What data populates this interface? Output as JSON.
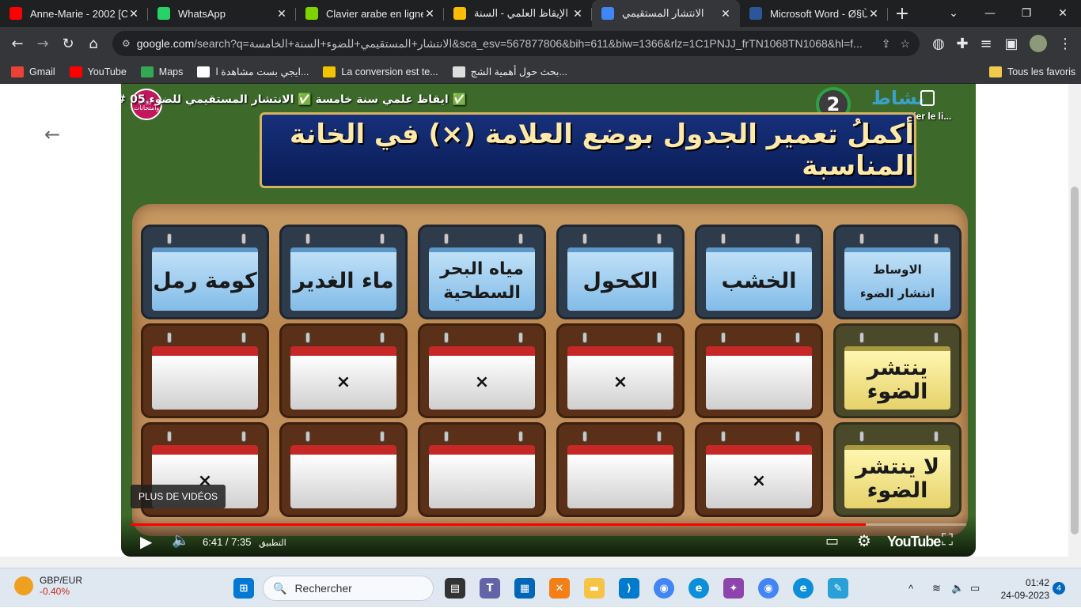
{
  "browser": {
    "tabs": [
      {
        "title": "Anne-Marie - 2002 [O",
        "favicon": "youtube-icon",
        "color": "#ff0000",
        "active": false
      },
      {
        "title": "WhatsApp",
        "favicon": "whatsapp-icon",
        "color": "#25d366",
        "active": false
      },
      {
        "title": "Clavier arabe en ligne",
        "favicon": "clavier-icon",
        "color": "#7fd400",
        "active": false
      },
      {
        "title": "الإيقاظ العلمي - السنة",
        "favicon": "drive-icon",
        "color": "#fbbc04",
        "active": false
      },
      {
        "title": "الانتشار المستقيمي",
        "favicon": "google-icon",
        "color": "#4285f4",
        "active": true
      },
      {
        "title": "Microsoft Word - Ø§Ù",
        "favicon": "word-icon",
        "color": "#2b579a",
        "active": false
      }
    ],
    "new_tab_label": "+",
    "url_domain": "google.com",
    "url_rest": "/search?q=الانتشار+المستقيمي+للضوء+السنة+الخامسة&sca_esv=567877806&bih=611&biw=1366&rlz=1C1PNJJ_frTN1068TN1068&hl=f...",
    "bookmarks": [
      {
        "label": "Gmail",
        "icon": "gmail-icon",
        "color": "#ea4335"
      },
      {
        "label": "YouTube",
        "icon": "youtube-icon",
        "color": "#ff0000"
      },
      {
        "label": "Maps",
        "icon": "maps-icon",
        "color": "#34a853"
      },
      {
        "label": "ايجي بست مشاهدة ا...",
        "icon": "egybest-icon",
        "color": "#ffffff"
      },
      {
        "label": "La conversion est te...",
        "icon": "conversion-icon",
        "color": "#f2c300"
      },
      {
        "label": "بحث حول أهمية الشج...",
        "icon": "doc-icon",
        "color": "#dddddd"
      }
    ],
    "all_bookmarks_label": "Tous les favoris"
  },
  "video": {
    "title": "✅ ايقاظ علمي سنة خامسة ✅ الانتشار المستقيمي للضوء 05 #",
    "channel_avatar_text": "دروس وامتحانات",
    "badge_number": "2",
    "activity_label": "نشاط",
    "copy_link_label": "Copier le li...",
    "banner_text": "أكملُ تعمير الجدول بوضع العلامة (×) في الخانة المناسبة",
    "more_videos_label": "PLUS DE VIDÉOS",
    "time_current": "6:41",
    "time_total": "7:35",
    "chapter_label": "التطبيق",
    "youtube_label": "YouTube",
    "progress_fraction": 0.88
  },
  "table": {
    "corner_top": "الاوساط",
    "corner_bottom": "انتشار الضوء",
    "columns": [
      "الخشب",
      "الكحول",
      "مياه البحر السطحية",
      "ماء الغدير",
      "كومة رمل"
    ],
    "rows": [
      {
        "label": "ينتشر الضوء",
        "marks": [
          "",
          "×",
          "×",
          "×",
          ""
        ]
      },
      {
        "label": "لا ينتشر الضوء",
        "marks": [
          "×",
          "",
          "",
          "",
          "×"
        ]
      }
    ]
  },
  "taskbar": {
    "weather_title": "GBP/EUR",
    "weather_value": "-0.40%",
    "search_placeholder": "Rechercher",
    "time": "01:42",
    "date": "24-09-2023",
    "notification_count": "4"
  }
}
